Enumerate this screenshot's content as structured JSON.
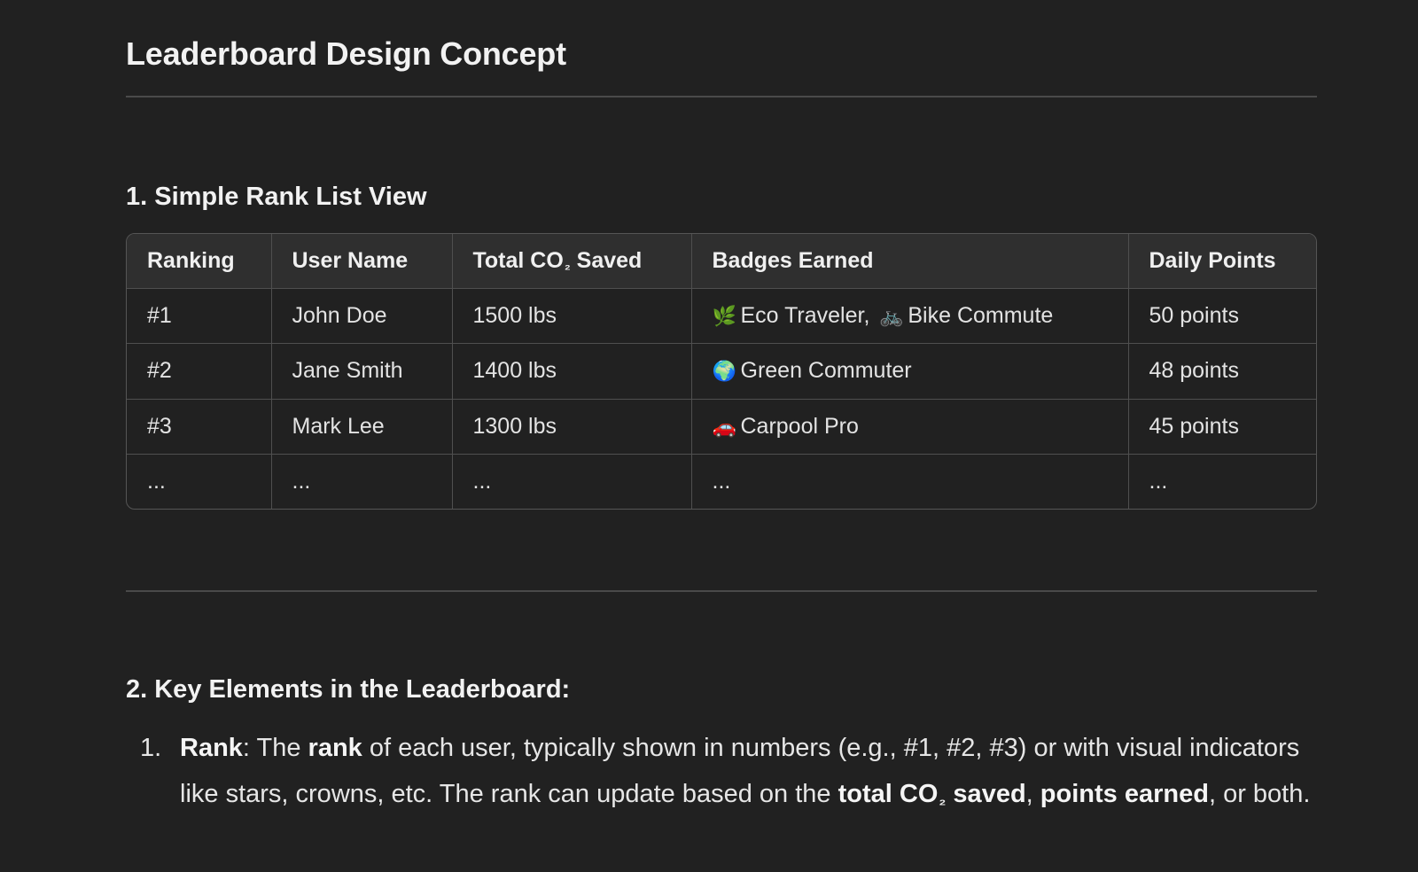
{
  "title": "Leaderboard Design Concept",
  "section1": {
    "heading": "1. Simple Rank List View",
    "table": {
      "headers": [
        "Ranking",
        "User Name",
        "Total CO",
        "₂",
        " Saved",
        "Badges Earned",
        "Daily Points"
      ],
      "rows": [
        {
          "rank": "#1",
          "name": "John Doe",
          "co2": "1500 lbs",
          "badges": [
            {
              "icon": "🌿",
              "icon_name": "herb-icon",
              "label": "Eco Traveler,"
            },
            {
              "icon": "🚲",
              "icon_name": "bicycle-icon",
              "label": "Bike Commute"
            }
          ],
          "points": "50 points"
        },
        {
          "rank": "#2",
          "name": "Jane Smith",
          "co2": "1400 lbs",
          "badges": [
            {
              "icon": "🌍",
              "icon_name": "globe-icon",
              "label": "Green Commuter"
            }
          ],
          "points": "48 points"
        },
        {
          "rank": "#3",
          "name": "Mark Lee",
          "co2": "1300 lbs",
          "badges": [
            {
              "icon": "🚗",
              "icon_name": "car-icon",
              "label": "Carpool Pro"
            }
          ],
          "points": "45 points"
        },
        {
          "rank": "...",
          "name": "...",
          "co2": "...",
          "badges_text": "...",
          "points": "..."
        }
      ]
    }
  },
  "section2": {
    "heading": "2. Key Elements in the Leaderboard:",
    "item1": {
      "number": "1.",
      "term": "Rank",
      "t1": ": The ",
      "b1": "rank",
      "t2": " of each user, typically shown in numbers (e.g., #1, #2, #3) or with visual indicators like stars, crowns, etc. The rank can update based on the ",
      "b2a": "total CO",
      "b2sub": "₂",
      "b2b": " saved",
      "t3": ", ",
      "b3": "points earned",
      "t4": ", or both."
    }
  }
}
